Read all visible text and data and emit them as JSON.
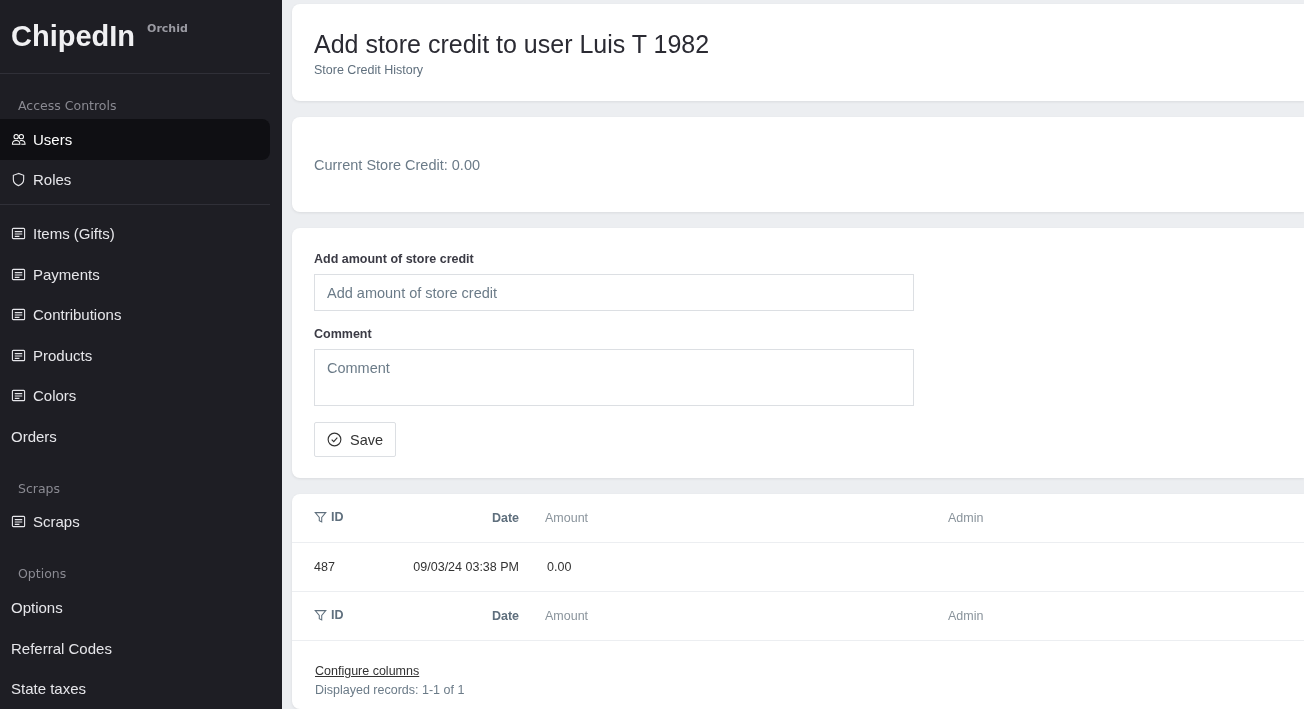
{
  "brand": {
    "name": "ChipedIn",
    "badge": "Orchid"
  },
  "sidebar": {
    "sections": [
      {
        "label": "Access Controls",
        "items": [
          {
            "label": "Users",
            "kind": "users",
            "selected": true
          },
          {
            "label": "Roles",
            "kind": "shield",
            "selected": false
          }
        ]
      },
      {
        "items": [
          {
            "label": "Items (Gifts)",
            "kind": "list",
            "selected": false
          },
          {
            "label": "Payments",
            "kind": "list",
            "selected": false
          },
          {
            "label": "Contributions",
            "kind": "list",
            "selected": false
          },
          {
            "label": "Products",
            "kind": "list",
            "selected": false
          },
          {
            "label": "Colors",
            "kind": "list",
            "selected": false
          },
          {
            "label": "Orders",
            "kind": "text",
            "selected": false
          }
        ]
      },
      {
        "label": "Scraps",
        "items": [
          {
            "label": "Scraps",
            "kind": "list",
            "selected": false
          }
        ]
      },
      {
        "label": "Options",
        "items": [
          {
            "label": "Options",
            "kind": "text",
            "selected": false
          },
          {
            "label": "Referral Codes",
            "kind": "text",
            "selected": false
          },
          {
            "label": "State taxes",
            "kind": "text",
            "selected": false
          }
        ]
      }
    ]
  },
  "header": {
    "title": "Add store credit to user Luis T 1982",
    "subtitle": "Store Credit History"
  },
  "current_credit": "Current Store Credit: 0.00",
  "form": {
    "amount": {
      "label": "Add amount of store credit",
      "placeholder": "Add amount of store credit"
    },
    "comment": {
      "label": "Comment",
      "placeholder": "Comment"
    },
    "save_button": "Save"
  },
  "table": {
    "columns": [
      {
        "label": "ID",
        "kind": "filter"
      },
      {
        "label": "Date",
        "kind": "bold"
      },
      {
        "label": "Amount",
        "kind": "plain"
      },
      {
        "label": "Admin",
        "kind": "plain"
      }
    ],
    "rows": [
      [
        "487",
        "09/03/24 03:38 PM",
        "0.00",
        ""
      ]
    ],
    "footer_columns": [
      {
        "label": "ID",
        "kind": "filter"
      },
      {
        "label": "Date",
        "kind": "bold"
      },
      {
        "label": "Amount",
        "kind": "plain"
      },
      {
        "label": "Admin",
        "kind": "plain"
      }
    ],
    "configure_link": "Configure columns",
    "records": "Displayed records: 1-1 of 1"
  }
}
